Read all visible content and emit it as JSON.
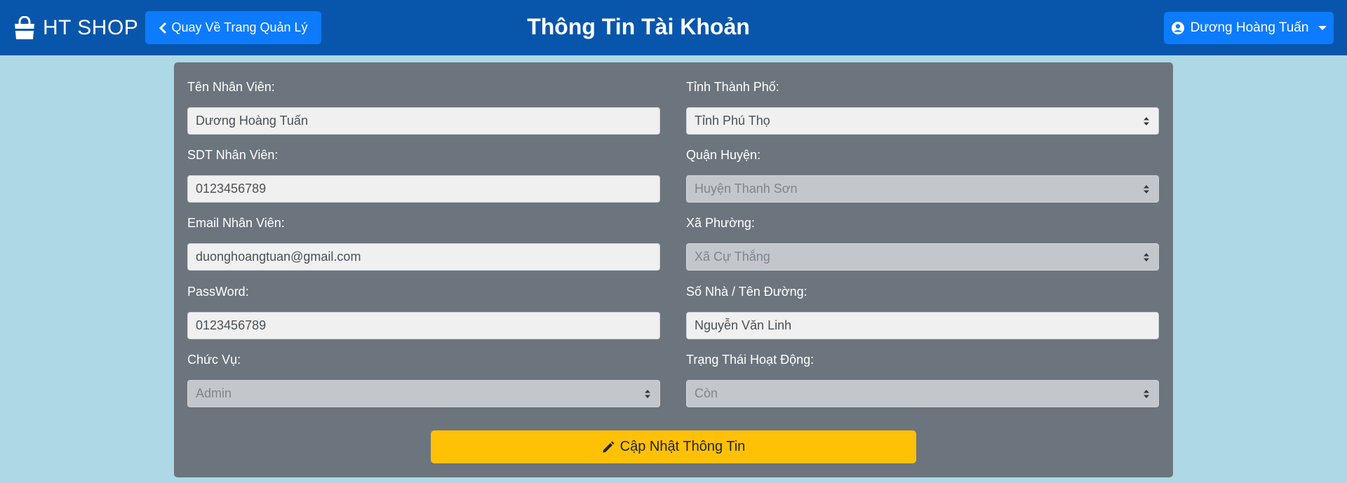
{
  "header": {
    "brand": "HT SHOP",
    "back_button": "Quay Về Trang Quản Lý",
    "title": "Thông Tin Tài Khoản",
    "user_menu": "Dương Hoàng Tuấn",
    "bar_color": "#0856ab",
    "button_color": "#0d7bfd"
  },
  "icons": {
    "brand": "shopping-bag-icon",
    "back": "chevron-left-icon",
    "user": "user-circle-icon",
    "user_caret": "caret-down-icon",
    "select": "sort-arrows-icon",
    "update": "pencil-icon"
  },
  "form": {
    "employee_name": {
      "label": "Tên Nhân Viên:",
      "value": "Dương Hoàng Tuấn"
    },
    "employee_phone": {
      "label": "SDT Nhân Viên:",
      "value": "0123456789"
    },
    "employee_email": {
      "label": "Email Nhân Viên:",
      "value": "duonghoangtuan@gmail.com"
    },
    "password": {
      "label": "PassWord:",
      "value": "0123456789"
    },
    "position": {
      "label": "Chức Vụ:",
      "value": "Admin",
      "disabled": true
    },
    "province": {
      "label": "Tỉnh Thành Phố:",
      "value": "Tỉnh Phú Thọ"
    },
    "district": {
      "label": "Quận Huyện:",
      "value": "Huyện Thanh Sơn",
      "disabled": true
    },
    "ward": {
      "label": "Xã Phường:",
      "value": "Xã Cự Thắng",
      "disabled": true
    },
    "street": {
      "label": "Số Nhà / Tên Đường:",
      "value": "Nguyễn Văn Linh"
    },
    "status": {
      "label": "Trạng Thái Hoạt Động:",
      "value": "Còn",
      "disabled": true
    },
    "update_button": "Cập Nhật Thông Tin",
    "update_color": "#ffc106"
  }
}
